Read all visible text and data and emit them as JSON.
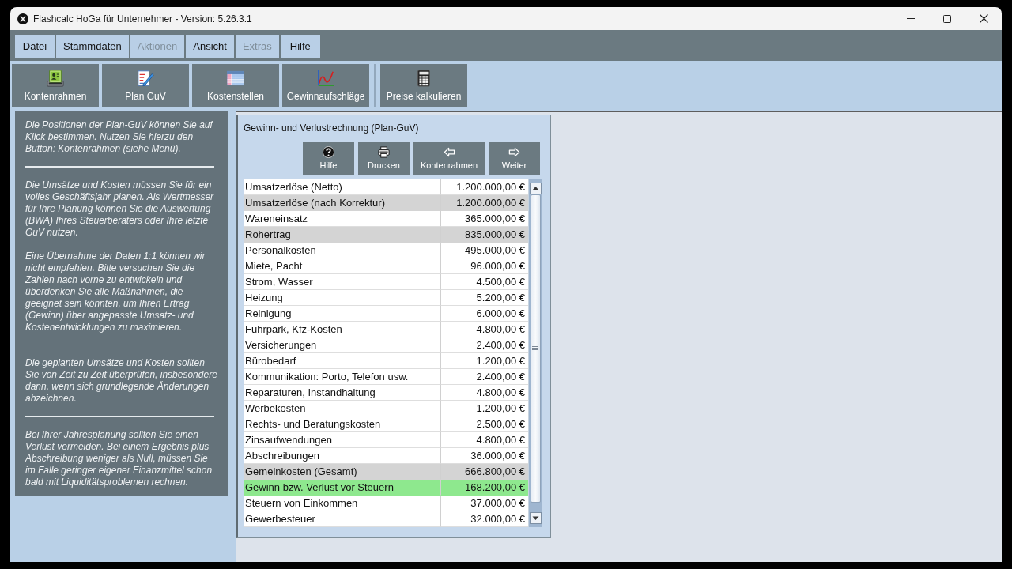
{
  "window": {
    "title": "Flashcalc HoGa für Unternehmer - Version: 5.26.3.1"
  },
  "menu": {
    "items": [
      {
        "label": "Datei",
        "disabled": false
      },
      {
        "label": "Stammdaten",
        "disabled": false
      },
      {
        "label": "Aktionen",
        "disabled": true
      },
      {
        "label": "Ansicht",
        "disabled": false
      },
      {
        "label": "Extras",
        "disabled": true
      },
      {
        "label": "Hilfe",
        "disabled": false
      }
    ]
  },
  "toolbar": {
    "groups": [
      {
        "buttons": [
          {
            "label": "Kontenrahmen"
          },
          {
            "label": "Plan GuV"
          },
          {
            "label": "Kostenstellen"
          },
          {
            "label": "Gewinnaufschläge"
          }
        ]
      },
      {
        "buttons": [
          {
            "label": "Preise kalkulieren"
          }
        ]
      }
    ]
  },
  "info_panel": {
    "sections": [
      {
        "paragraphs": [
          "Die Positionen der Plan-GuV können Sie auf Klick bestimmen. Nutzen Sie hierzu den Button: Kontenrahmen (siehe Menü)."
        ]
      },
      {
        "paragraphs": [
          "Die Umsätze und Kosten müssen Sie für ein volles Geschäftsjahr planen. Als Wertmesser für Ihre Planung können Sie die Auswertung (BWA) Ihres Steuerberaters oder Ihre letzte GuV nutzen.",
          "Eine Übernahme der Daten 1:1 können wir nicht empfehlen. Bitte versuchen Sie die Zahlen nach vorne zu entwickeln und überdenken Sie alle Maßnahmen, die geeignet sein könnten, um Ihren Ertrag (Gewinn) über angepasste Umsatz- und Kostenentwicklungen zu maximieren."
        ]
      },
      {
        "paragraphs": [
          "Die geplanten Umsätze und Kosten sollten Sie von Zeit zu Zeit überprüfen, insbesondere dann, wenn sich grundlegende Änderungen abzeichnen."
        ]
      },
      {
        "paragraphs": [
          "Bei Ihrer Jahresplanung sollten Sie einen Verlust vermeiden. Bei einem Ergebnis plus Abschreibung weniger als Null, müssen Sie im Falle geringer eigener Finanzmittel schon bald mit Liquiditätsproblemen rechnen."
        ]
      }
    ]
  },
  "guv_panel": {
    "title": "Gewinn- und Verlustrechnung (Plan-GuV)",
    "buttons": [
      {
        "label": "Hilfe"
      },
      {
        "label": "Drucken"
      },
      {
        "label": "Kontenrahmen"
      },
      {
        "label": "Weiter"
      }
    ],
    "table": {
      "rows": [
        {
          "label": "Umsatzerlöse (Netto)",
          "amount": "1.200.000,00 €",
          "kind": "item"
        },
        {
          "label": "Umsatzerlöse (nach Korrektur)",
          "amount": "1.200.000,00 €",
          "kind": "subtotal"
        },
        {
          "label": "Wareneinsatz",
          "amount": "365.000,00 €",
          "kind": "item"
        },
        {
          "label": "Rohertrag",
          "amount": "835.000,00 €",
          "kind": "subtotal"
        },
        {
          "label": "Personalkosten",
          "amount": "495.000,00 €",
          "kind": "item"
        },
        {
          "label": "Miete, Pacht",
          "amount": "96.000,00 €",
          "kind": "item"
        },
        {
          "label": "Strom, Wasser",
          "amount": "4.500,00 €",
          "kind": "item"
        },
        {
          "label": "Heizung",
          "amount": "5.200,00 €",
          "kind": "item"
        },
        {
          "label": "Reinigung",
          "amount": "6.000,00 €",
          "kind": "item"
        },
        {
          "label": "Fuhrpark, Kfz-Kosten",
          "amount": "4.800,00 €",
          "kind": "item"
        },
        {
          "label": "Versicherungen",
          "amount": "2.400,00 €",
          "kind": "item"
        },
        {
          "label": "Bürobedarf",
          "amount": "1.200,00 €",
          "kind": "item"
        },
        {
          "label": "Kommunikation: Porto, Telefon usw.",
          "amount": "2.400,00 €",
          "kind": "item"
        },
        {
          "label": "Reparaturen, Instandhaltung",
          "amount": "4.800,00 €",
          "kind": "item"
        },
        {
          "label": "Werbekosten",
          "amount": "1.200,00 €",
          "kind": "item"
        },
        {
          "label": "Rechts- und Beratungskosten",
          "amount": "2.500,00 €",
          "kind": "item"
        },
        {
          "label": "Zinsaufwendungen",
          "amount": "4.800,00 €",
          "kind": "item"
        },
        {
          "label": "Abschreibungen",
          "amount": "36.000,00 €",
          "kind": "item"
        },
        {
          "label": "Gemeinkosten (Gesamt)",
          "amount": "666.800,00 €",
          "kind": "subtotal"
        },
        {
          "label": "Gewinn bzw. Verlust vor Steuern",
          "amount": "168.200,00 €",
          "kind": "result"
        },
        {
          "label": "Steuern von Einkommen",
          "amount": "37.000,00 €",
          "kind": "item"
        },
        {
          "label": "Gewerbesteuer",
          "amount": "32.000,00 €",
          "kind": "item"
        }
      ]
    }
  }
}
